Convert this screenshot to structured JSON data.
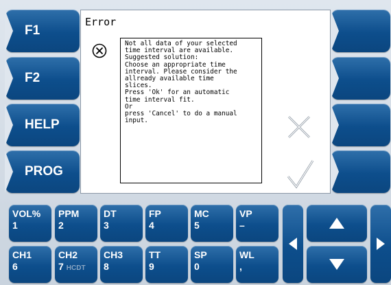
{
  "softkeys_left": [
    {
      "label": "F1"
    },
    {
      "label": "F2"
    },
    {
      "label": "HELP"
    },
    {
      "label": "PROG"
    }
  ],
  "dialog": {
    "title": "Error",
    "message": "Not all data of your selected\ntime interval are available.\nSuggested solution:\nChoose an appropriate time\ninterval. Please consider the\nallready available time\nslices.\nPress 'Ok' for an automatic\ntime interval fit.\nOr\npress 'Cancel' to do a manual\ninput.",
    "icon": "error-circle-x-icon",
    "cancel_icon": "cancel-x-icon",
    "ok_icon": "ok-check-icon"
  },
  "keypad": {
    "row1": [
      {
        "top": "VOL%",
        "bottom": "1"
      },
      {
        "top": "PPM",
        "bottom": "2"
      },
      {
        "top": "DT",
        "bottom": "3"
      },
      {
        "top": "FP",
        "bottom": "4"
      },
      {
        "top": "MC",
        "bottom": "5"
      },
      {
        "top": "VP",
        "bottom": "–"
      }
    ],
    "row2": [
      {
        "top": "CH1",
        "bottom": "6"
      },
      {
        "top": "CH2",
        "bottom": "7",
        "extra": "HCDT"
      },
      {
        "top": "CH3",
        "bottom": "8"
      },
      {
        "top": "TT",
        "bottom": "9"
      },
      {
        "top": "SP",
        "bottom": "0"
      },
      {
        "top": "WL",
        "bottom": ","
      }
    ],
    "nav_icons": [
      "arrow-left-icon",
      "arrow-up-icon",
      "arrow-down-icon",
      "arrow-right-icon"
    ]
  },
  "colors": {
    "key_blue": "#0d4e8c",
    "background": "#dfe6ee"
  }
}
